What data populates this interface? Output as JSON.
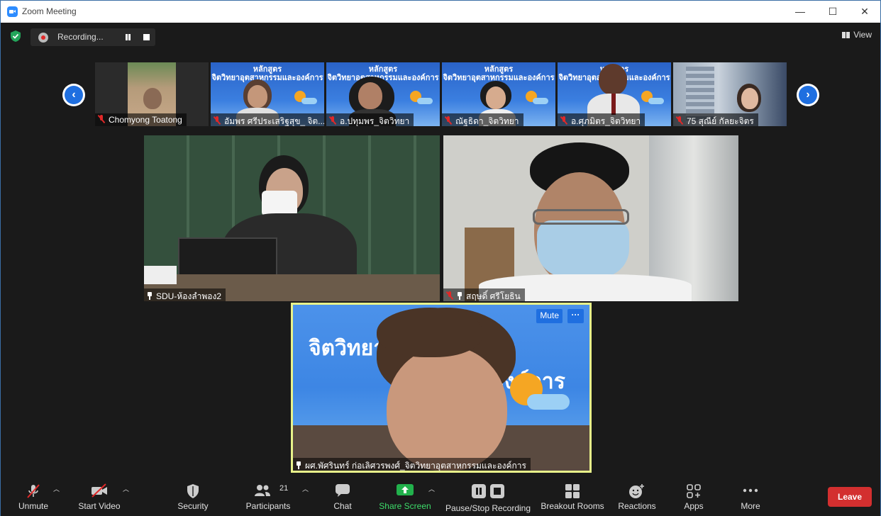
{
  "window": {
    "title": "Zoom Meeting"
  },
  "window_controls": {
    "minimize": "—",
    "maximize": "☐",
    "close": "✕"
  },
  "recording": {
    "label": "Recording..."
  },
  "view": {
    "label": "View"
  },
  "thumbnails": [
    {
      "name": "Chomyong Toatong"
    },
    {
      "name": "อัมพร ศรีประเสริฐสุข_ จิต...",
      "slide_line1": "หลักสูตร",
      "slide_line2": "จิตวิทยาอุตสาหกรรมและองค์การ"
    },
    {
      "name": "อ.ปทุมพร_จิตวิทยา",
      "slide_line1": "หลักสูตร",
      "slide_line2": "จิตวิทยาอุตสาหกรรมและองค์การ"
    },
    {
      "name": "ณัฐธิดา_จิตวิทยา",
      "slide_line1": "หลักสูตร",
      "slide_line2": "จิตวิทยาอุตสาหกรรมและองค์การ"
    },
    {
      "name": "อ.ศุภมิตร_จิตวิทยา",
      "slide_line1": "หลักสูตร",
      "slide_line2": "จิตวิทยาอุตสาหกรรมและองค์การ"
    },
    {
      "name": "75 สุณีย์ กัลยะจิตร"
    }
  ],
  "main_tiles": [
    {
      "name": "SDU-ห้องลำพอง2"
    },
    {
      "name": "สฤษดิ์ ศรีโยธิน"
    }
  ],
  "active_speaker": {
    "name": "ผศ.พัศรินทร์ ก่อเลิศวรพงศ์_จิตวิทยาอุตสาหกรรมและองค์การ",
    "slide_text_left": "จิตวิทยา",
    "slide_text_right": "ละองค์การ",
    "mute_label": "Mute",
    "more_label": "···"
  },
  "toolbar": {
    "unmute": "Unmute",
    "start_video": "Start Video",
    "security": "Security",
    "participants": "Participants",
    "participants_count": "21",
    "chat": "Chat",
    "share_screen": "Share Screen",
    "pause_stop_recording": "Pause/Stop Recording",
    "breakout_rooms": "Breakout Rooms",
    "reactions": "Reactions",
    "apps": "Apps",
    "more": "More",
    "leave": "Leave"
  },
  "colors": {
    "accent_blue": "#1f6fe0",
    "leave_red": "#d32f2f",
    "share_green": "#22b14c",
    "active_border": "#e8f28a",
    "muted_red": "#e02828"
  }
}
